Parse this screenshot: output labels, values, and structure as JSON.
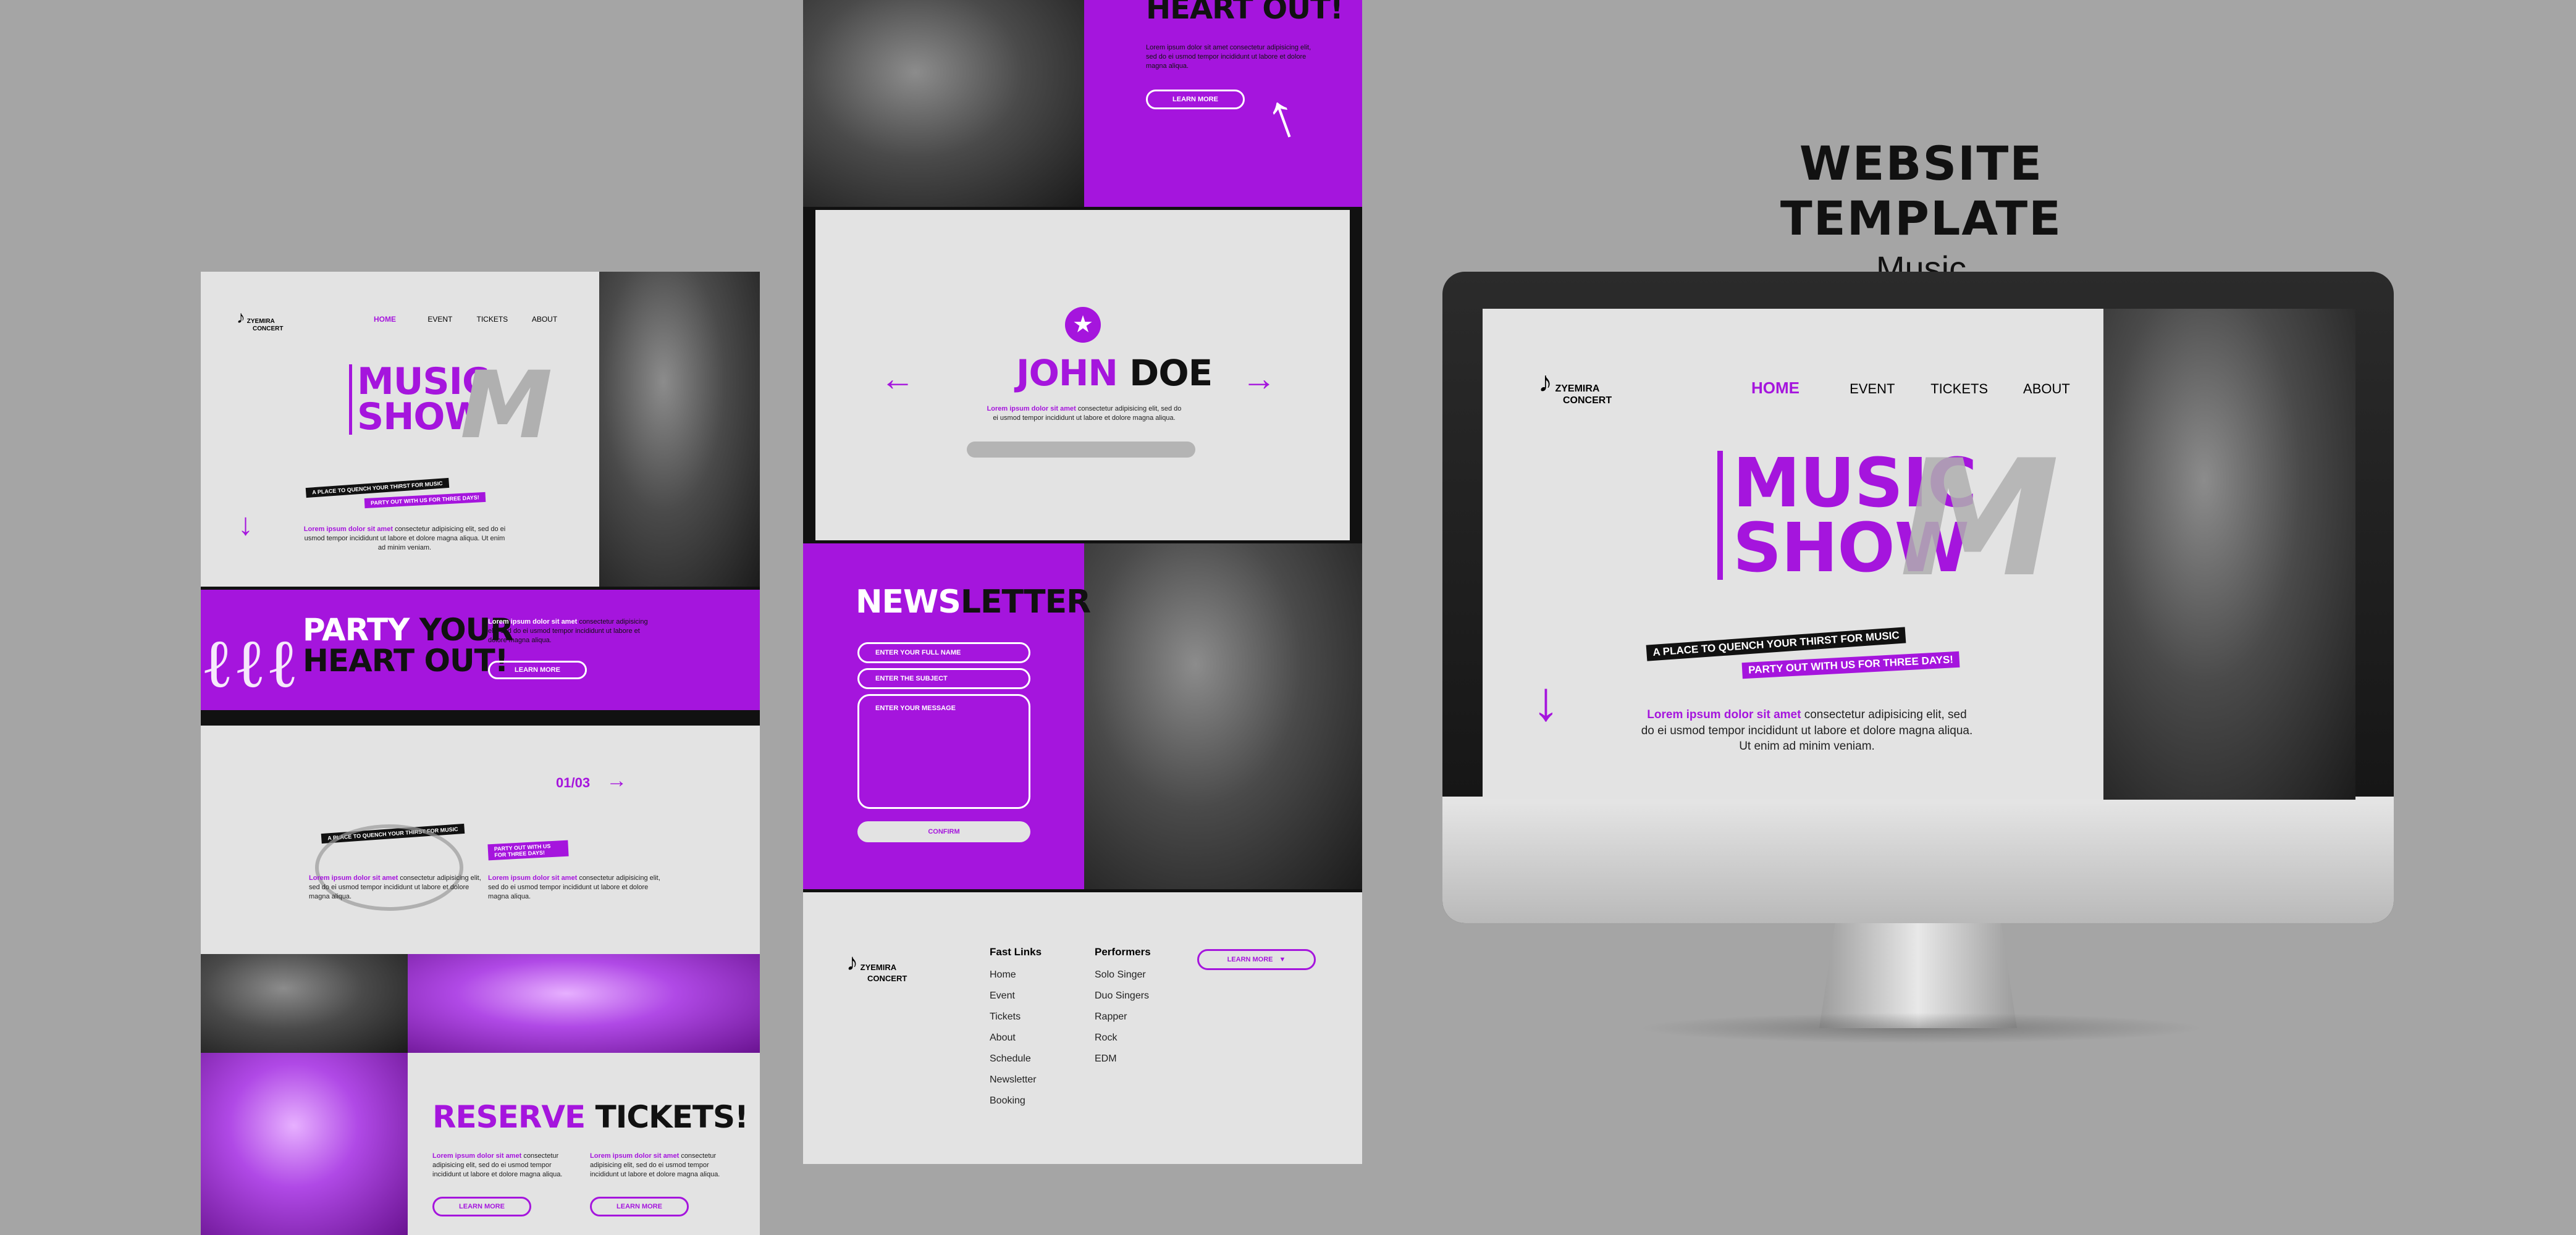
{
  "header": {
    "title": "WEBSITE TEMPLATE",
    "subtitle": "Music"
  },
  "logo": {
    "line1": "ZYEMIRA",
    "line2": "CONCERT"
  },
  "nav": {
    "home": "HOME",
    "event": "EVENT",
    "tickets": "TICKETS",
    "about": "ABOUT"
  },
  "hero": {
    "title1": "MUSIC",
    "title2": "SHOW",
    "tag1": "A PLACE TO QUENCH YOUR THIRST FOR MUSIC",
    "tag2": "PARTY OUT WITH US FOR THREE DAYS!",
    "lorem_bold": "Lorem ipsum dolor sit amet",
    "lorem_rest": "consectetur adipisicing elit, sed do ei usmod tempor incididunt ut labore et dolore magna aliqua. Ut enim ad minim veniam."
  },
  "party": {
    "title1": "PARTY",
    "title2": "YOUR",
    "title3": "HEART OUT!",
    "lorem_bold": "Lorem ipsum dolor sit amet",
    "lorem_rest": "consectetur adipisicing elit, sed do ei usmod tempor incididunt ut labore et dolore magna aliqua.",
    "button": "LEARN MORE"
  },
  "slider": {
    "counter": "01/03",
    "tag1": "A PLACE TO QUENCH YOUR THIRST FOR MUSIC",
    "tag2": "PARTY OUT WITH US FOR THREE DAYS!",
    "col1_bold": "Lorem ipsum dolor sit amet",
    "col1_rest": "consectetur adipisicing elit, sed do ei usmod tempor incididunt ut labore et dolore magna aliqua.",
    "col2_bold": "Lorem ipsum dolor sit amet",
    "col2_rest": "consectetur adipisicing elit, sed do ei usmod tempor incididunt ut labore et dolore magna aliqua."
  },
  "reserve": {
    "title1": "RESERVE",
    "title2": "TICKETS!",
    "lorem_bold": "Lorem ipsum dolor sit amet",
    "lorem_rest": "consectetur adipisicing elit, sed do ei usmod tempor incididunt ut labore et dolore magna aliqua.",
    "button": "LEARN MORE"
  },
  "middle": {
    "top_title": "HEART OUT!",
    "top_lorem": "Lorem ipsum dolor sit amet consectetur adipisicing elit, sed do ei usmod tempor incididunt ut labore et dolore magna aliqua.",
    "top_button": "LEARN MORE",
    "performer_first": "JOHN",
    "performer_last": "DOE",
    "performer_lorem_bold": "Lorem ipsum dolor sit amet",
    "performer_lorem_rest": "consectetur adipisicing elit, sed do ei usmod tempor incididunt ut labore et dolore magna aliqua."
  },
  "newsletter": {
    "title1": "NEWS",
    "title2": "LETTER",
    "name_placeholder": "ENTER YOUR FULL NAME",
    "subject_placeholder": "ENTER THE SUBJECT",
    "message_placeholder": "ENTER YOUR MESSAGE",
    "confirm": "CONFIRM"
  },
  "footer": {
    "fast_links_title": "Fast Links",
    "fast_links": [
      "Home",
      "Event",
      "Tickets",
      "About",
      "Schedule",
      "Newsletter",
      "Booking"
    ],
    "performers_title": "Performers",
    "performers": [
      "Solo Singer",
      "Duo Singers",
      "Rapper",
      "Rock",
      "EDM"
    ],
    "button": "LEARN MORE"
  },
  "colors": {
    "accent": "#a515dd",
    "background": "#a5a5a5",
    "panel": "#e3e3e3"
  }
}
